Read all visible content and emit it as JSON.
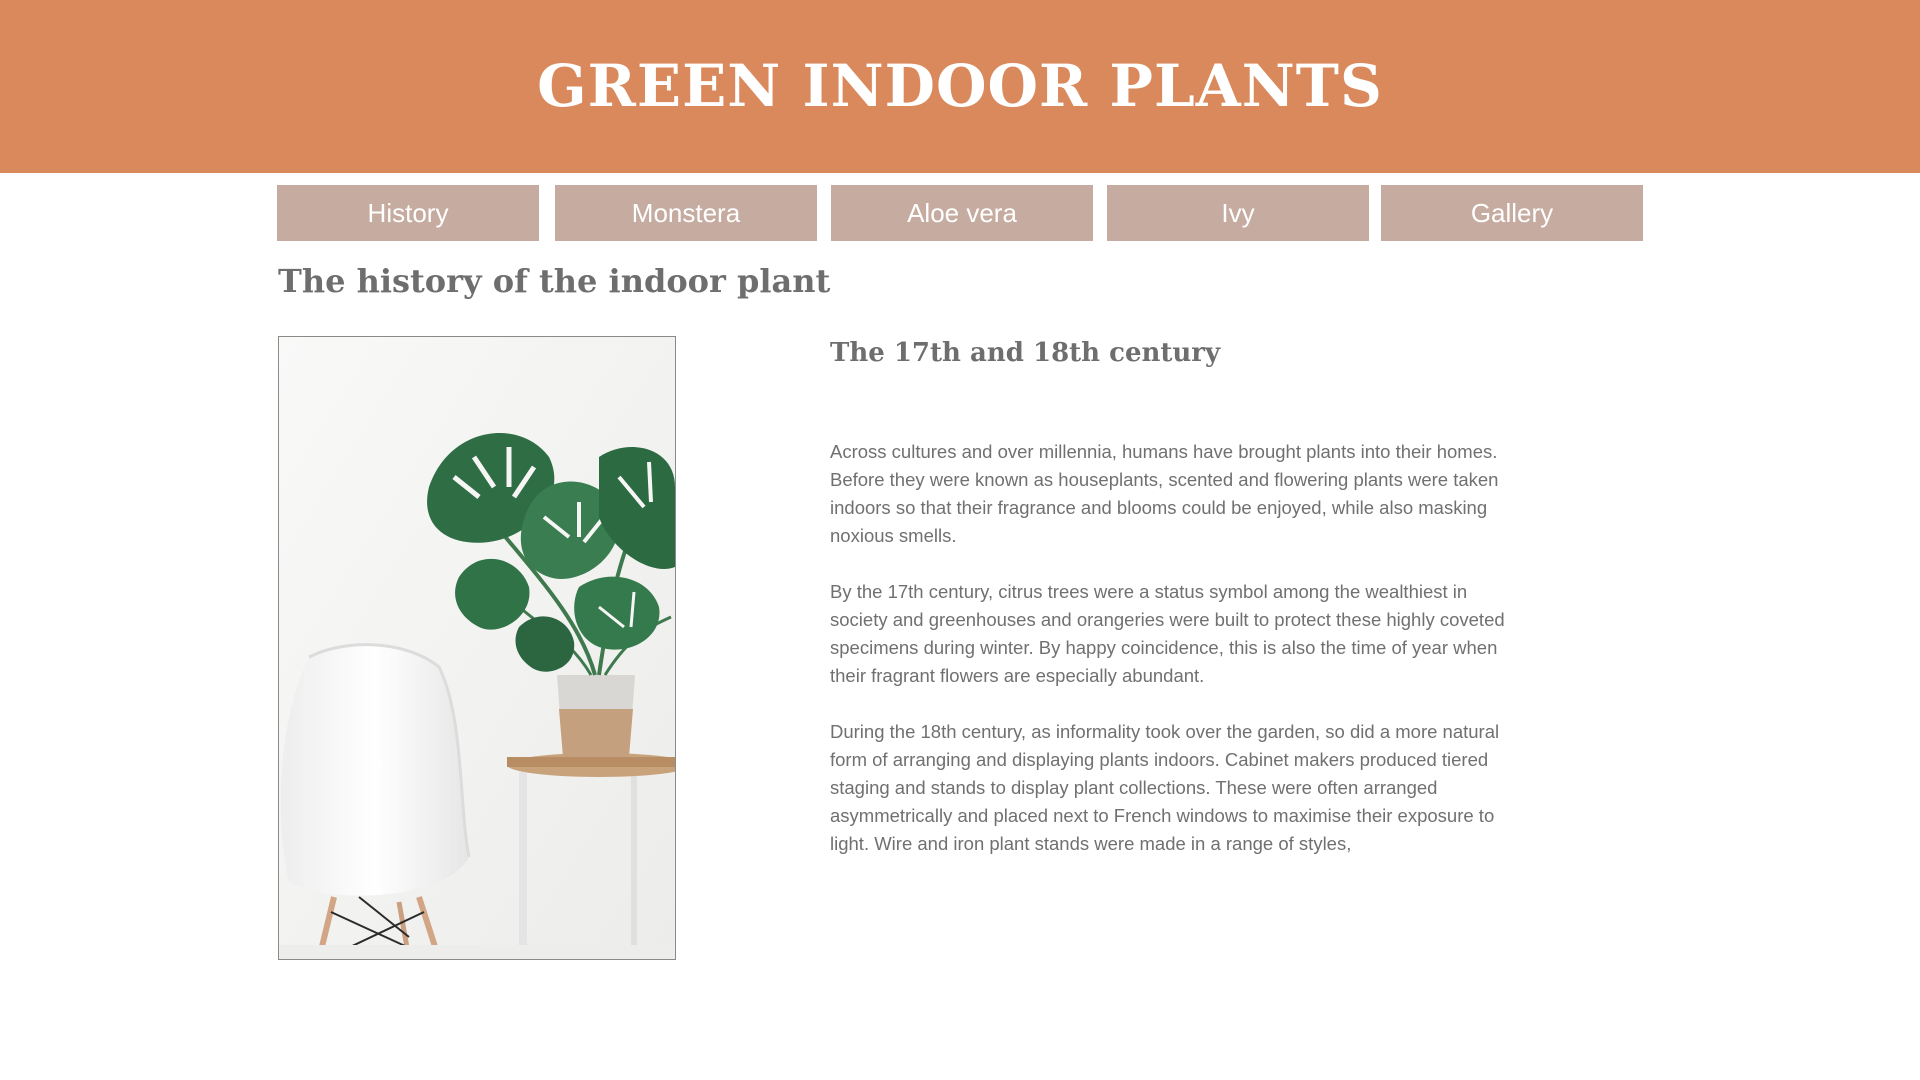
{
  "header": {
    "title": "GREEN INDOOR PLANTS",
    "background_color": "#d9895c"
  },
  "nav": {
    "button_color": "#c5aba0",
    "items": [
      {
        "label": "History"
      },
      {
        "label": "Monstera"
      },
      {
        "label": "Aloe vera"
      },
      {
        "label": "Ivy"
      },
      {
        "label": "Gallery"
      }
    ]
  },
  "main": {
    "heading": "The history of the indoor plant",
    "image": {
      "subject": "white chair beside a monstera plant on a wooden stand"
    },
    "section_heading": "The 17th and 18th century",
    "paragraphs": [
      "Across cultures and over millennia, humans have brought plants into their homes. Before they were known as houseplants, scented and flowering plants were taken indoors so that their fragrance and blooms could be enjoyed, while also masking noxious smells.",
      "By the 17th century, citrus trees were a status symbol among the wealthiest in society and greenhouses and orangeries were built to protect these highly coveted specimens during winter. By happy coincidence, this is also the time of year when their fragrant flowers are especially abundant.",
      "During the 18th century, as informality took over the garden, so did a more natural form of arranging and displaying plants indoors. Cabinet makers produced tiered staging and stands to display plant collections. These were often arranged asymmetrically and placed next to French windows to maximise their exposure to light. Wire and iron plant stands were made in a range of styles,"
    ]
  }
}
